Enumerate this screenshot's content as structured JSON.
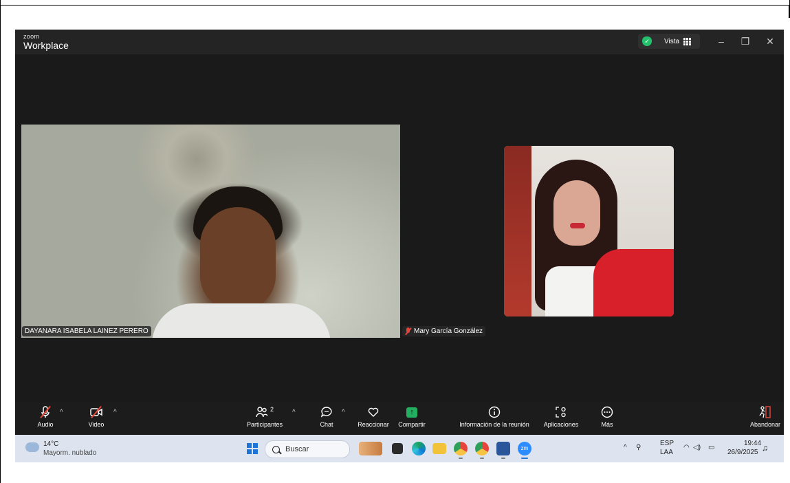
{
  "window": {
    "brand_small": "zoom",
    "brand_large": "Workplace",
    "view_label": "Vista"
  },
  "participants": [
    {
      "name": "DAYANARA ISABELA LAINEZ PERERO"
    },
    {
      "name": "Mary García González",
      "muted": true
    }
  ],
  "toolbar": {
    "audio_label": "Audio",
    "video_label": "Video",
    "participants_label": "Participantes",
    "participants_count": "2",
    "chat_label": "Chat",
    "react_label": "Reaccionar",
    "share_label": "Compartir",
    "info_label": "Información de la reunión",
    "apps_label": "Aplicaciones",
    "more_label": "Más",
    "leave_label": "Abandonar"
  },
  "taskbar": {
    "weather_temp": "14°C",
    "weather_desc": "Mayorm. nublado",
    "search_placeholder": "Buscar",
    "lang_top": "ESP",
    "lang_bottom": "LAA",
    "time": "19:44",
    "date": "26/9/2025"
  },
  "colors": {
    "accent_green": "#23c16b",
    "muted_red": "#e2453c",
    "share_green": "#22b060"
  }
}
